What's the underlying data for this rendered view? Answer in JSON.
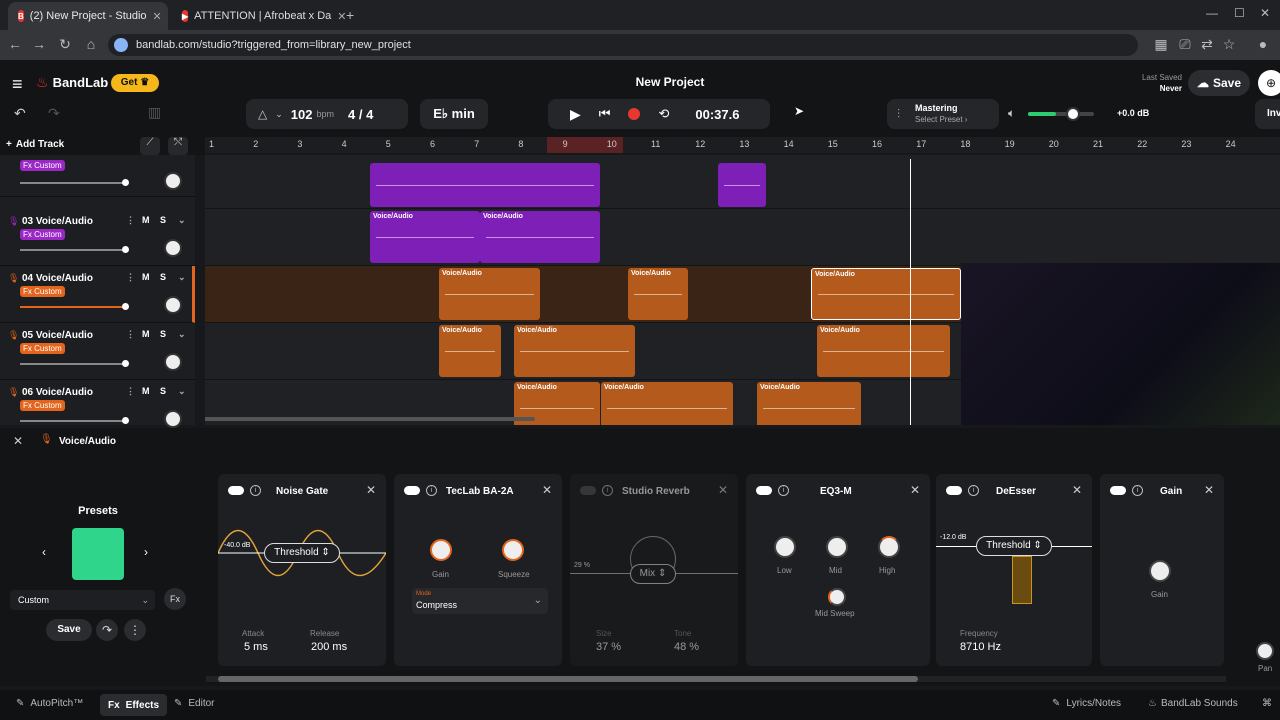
{
  "browser": {
    "tabs": [
      {
        "label": "(2) New Project - Studio",
        "active": true
      },
      {
        "label": "ATTENTION | Afrobeat x Da",
        "active": false
      }
    ],
    "url": "bandlab.com/studio?triggered_from=library_new_project"
  },
  "header": {
    "brand": "BandLab",
    "get_label": "Get",
    "title": "New Project",
    "last_saved_label": "Last Saved",
    "last_saved_value": "Never",
    "save_label": "Save",
    "inv_label": "Inv"
  },
  "transport": {
    "bpm": "102",
    "bpm_unit": "bpm",
    "time_sig": "4 / 4",
    "key": "E♭ min",
    "time": "00:37.6",
    "mastering_label": "Mastering",
    "mastering_preset": "Select Preset",
    "volume_label": "+0.0 dB"
  },
  "tracks_panel": {
    "add_track_label": "Add Track",
    "tracks": [
      {
        "name": "",
        "fx": "Fx Custom"
      },
      {
        "name": "03 Voice/Audio",
        "fx": "Fx Custom"
      },
      {
        "name": "04 Voice/Audio",
        "fx": "Fx Custom"
      },
      {
        "name": "05 Voice/Audio",
        "fx": "Fx Custom"
      },
      {
        "name": "06 Voice/Audio",
        "fx": "Fx Custom"
      }
    ],
    "m_label": "M",
    "s_label": "S"
  },
  "ruler": [
    "1",
    "2",
    "3",
    "4",
    "5",
    "6",
    "7",
    "8",
    "9",
    "10",
    "11",
    "12",
    "13",
    "14",
    "15",
    "16",
    "17",
    "18",
    "19",
    "20",
    "21",
    "22",
    "23",
    "24"
  ],
  "clip_label": "Voice/Audio",
  "effects": {
    "track_name": "Voice/Audio",
    "presets_label": "Presets",
    "preset_value": "Custom",
    "save_label": "Save",
    "noise_gate": {
      "title": "Noise Gate",
      "level": "-40.0 dB",
      "threshold": "Threshold",
      "attack_label": "Attack",
      "attack": "5 ms",
      "release_label": "Release",
      "release": "200 ms"
    },
    "teclab": {
      "title": "TecLab BA-2A",
      "gain_label": "Gain",
      "squeeze_label": "Squeeze",
      "mode_label": "Mode",
      "mode": "Compress"
    },
    "reverb": {
      "title": "Studio Reverb",
      "mix_pct": "29 %",
      "mix": "Mix",
      "size_label": "Size",
      "size": "37 %",
      "tone_label": "Tone",
      "tone": "48 %"
    },
    "eq": {
      "title": "EQ3-M",
      "low": "Low",
      "mid": "Mid",
      "high": "High",
      "sweep": "Mid Sweep"
    },
    "deesser": {
      "title": "DeEsser",
      "level": "-12.0 dB",
      "threshold": "Threshold",
      "freq_label": "Frequency",
      "freq": "8710 Hz"
    },
    "gain": {
      "title": "Gain",
      "gain_label": "Gain"
    },
    "pan_label": "Pan"
  },
  "bottom": {
    "autopitch": "AutoPitch™",
    "effects": "Effects",
    "editor": "Editor",
    "lyrics": "Lyrics/Notes",
    "sounds": "BandLab Sounds"
  },
  "colors": {
    "accent": "#e8372e",
    "orange": "#b45a1d",
    "purple": "#7e1fb8",
    "record": "#e8372e"
  }
}
